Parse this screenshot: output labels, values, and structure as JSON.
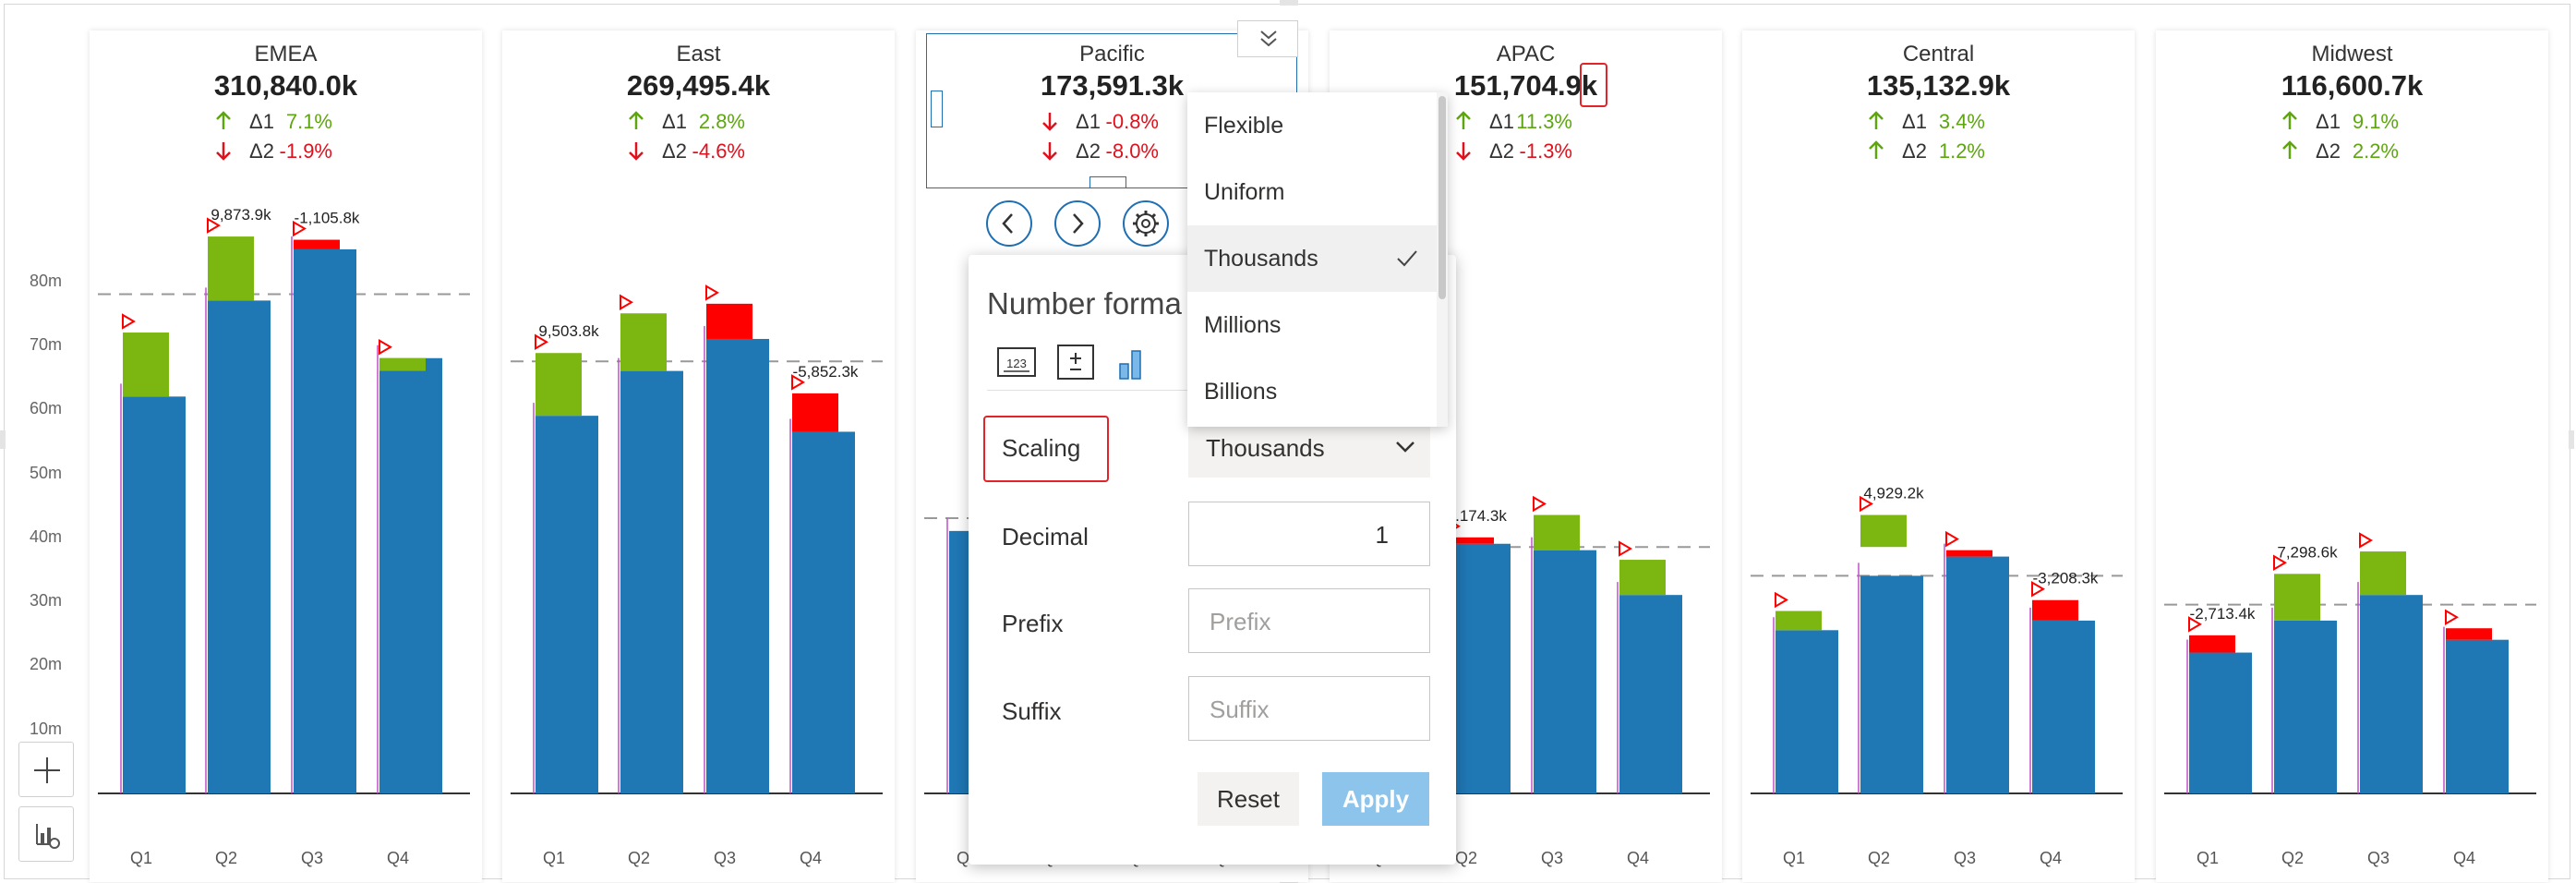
{
  "axis_ticks": [
    "10m",
    "20m",
    "30m",
    "40m",
    "50m",
    "60m",
    "70m",
    "80m"
  ],
  "quarters": [
    "Q1",
    "Q2",
    "Q3",
    "Q4"
  ],
  "colors": {
    "bar": "#1f77b4",
    "positive": "#7cb610",
    "negative": "#ff0000",
    "up_arrow": "#5ea610",
    "down_arrow": "#e0101d",
    "accent": "#1f6fb2",
    "reference_line": "#999999"
  },
  "chart_data": {
    "type": "bar",
    "title": "",
    "ylabel": "",
    "ylim": [
      0,
      100
    ],
    "y_unit": "m",
    "categories": [
      "Q1",
      "Q2",
      "Q3",
      "Q4"
    ],
    "panels": [
      {
        "title": "EMEA",
        "total": "310,840.0k",
        "delta1": "7.1%",
        "delta1_dir": "up",
        "delta2": "-1.9%",
        "delta2_dir": "down",
        "reference": 78,
        "series": [
          {
            "name": "",
            "values": [
              62,
              77,
              85,
              68
            ]
          }
        ],
        "variance": [
          {
            "from": 62,
            "to": 72,
            "sign": "positive",
            "label": ""
          },
          {
            "from": 77,
            "to": 87,
            "sign": "positive",
            "label": "9,873.9k"
          },
          {
            "from": 85,
            "to": 86.5,
            "sign": "negative",
            "label": "-1,105.8k"
          },
          {
            "from": 66,
            "to": 68,
            "sign": "positive",
            "label": ""
          }
        ]
      },
      {
        "title": "East",
        "total": "269,495.4k",
        "delta1": "2.8%",
        "delta1_dir": "up",
        "delta2": "-4.6%",
        "delta2_dir": "down",
        "reference": 67.5,
        "series": [
          {
            "name": "",
            "values": [
              59,
              66,
              71,
              56.5
            ]
          }
        ],
        "variance": [
          {
            "from": 59,
            "to": 68.8,
            "sign": "positive",
            "label": "9,503.8k"
          },
          {
            "from": 66,
            "to": 75,
            "sign": "positive",
            "label": ""
          },
          {
            "from": 71,
            "to": 76.5,
            "sign": "negative",
            "label": ""
          },
          {
            "from": 56.5,
            "to": 62.5,
            "sign": "negative",
            "label": "-5,852.3k"
          }
        ]
      },
      {
        "title": "Pacific",
        "total": "173,591.3k",
        "delta1": "-0.8%",
        "delta1_dir": "down",
        "delta2": "-8.0%",
        "delta2_dir": "down",
        "reference": 43,
        "series": [
          {
            "name": "",
            "values": [
              41,
              0,
              0,
              0
            ]
          }
        ],
        "variance": []
      },
      {
        "title": "APAC",
        "total": "151,704.9k",
        "delta1": "11.3%",
        "delta1_dir": "up",
        "delta2": "-1.3%",
        "delta2_dir": "down",
        "reference": 38.5,
        "series": [
          {
            "name": "",
            "values": [
              0,
              39,
              38,
              31
            ]
          }
        ],
        "variance": [
          {
            "from": 39,
            "to": 40,
            "sign": "negative",
            "label": ".174.3k"
          },
          {
            "from": 38,
            "to": 43.5,
            "sign": "positive",
            "label": ""
          },
          {
            "from": 31,
            "to": 36.5,
            "sign": "positive",
            "label": ""
          }
        ]
      },
      {
        "title": "Central",
        "total": "135,132.9k",
        "delta1": "3.4%",
        "delta1_dir": "up",
        "delta2": "1.2%",
        "delta2_dir": "up",
        "reference": 34,
        "series": [
          {
            "name": "",
            "values": [
              25.5,
              34,
              37,
              27
            ]
          }
        ],
        "variance": [
          {
            "from": 25.5,
            "to": 28.5,
            "sign": "positive",
            "label": ""
          },
          {
            "from": 38.5,
            "to": 43.5,
            "sign": "positive",
            "label": "4,929.2k"
          },
          {
            "from": 37,
            "to": 38,
            "sign": "negative",
            "label": ""
          },
          {
            "from": 27,
            "to": 30.2,
            "sign": "negative",
            "label": "-3,208.3k"
          }
        ]
      },
      {
        "title": "Midwest",
        "total": "116,600.7k",
        "delta1": "9.1%",
        "delta1_dir": "up",
        "delta2": "2.2%",
        "delta2_dir": "up",
        "reference": 29.5,
        "series": [
          {
            "name": "",
            "values": [
              22,
              27,
              31,
              24
            ]
          }
        ],
        "variance": [
          {
            "from": 22,
            "to": 24.7,
            "sign": "negative",
            "label": "-2,713.4k"
          },
          {
            "from": 27,
            "to": 34.3,
            "sign": "positive",
            "label": "7,298.6k"
          },
          {
            "from": 31,
            "to": 37.8,
            "sign": "positive",
            "label": ""
          },
          {
            "from": 24,
            "to": 25.8,
            "sign": "negative",
            "label": ""
          }
        ]
      }
    ]
  },
  "scaling_dropdown": {
    "options": [
      "Flexible",
      "Uniform",
      "Thousands",
      "Millions",
      "Billions"
    ],
    "selected": "Thousands"
  },
  "number_format": {
    "title": "Number forma",
    "scaling_label": "Scaling",
    "scaling_value": "Thousands",
    "decimal_label": "Decimal",
    "decimal_value": "1",
    "prefix_label": "Prefix",
    "prefix_placeholder": "Prefix",
    "suffix_label": "Suffix",
    "suffix_placeholder": "Suffix",
    "reset_label": "Reset",
    "apply_label": "Apply",
    "tab_icons": [
      "number-123-icon",
      "plus-minus-icon",
      "bar-chart-icon"
    ]
  },
  "nav_icons": [
    "chevron-left-icon",
    "chevron-right-icon",
    "gear-icon",
    "double-chevron-down-icon"
  ],
  "side_icons": [
    "plus-icon",
    "chart-settings-icon"
  ]
}
